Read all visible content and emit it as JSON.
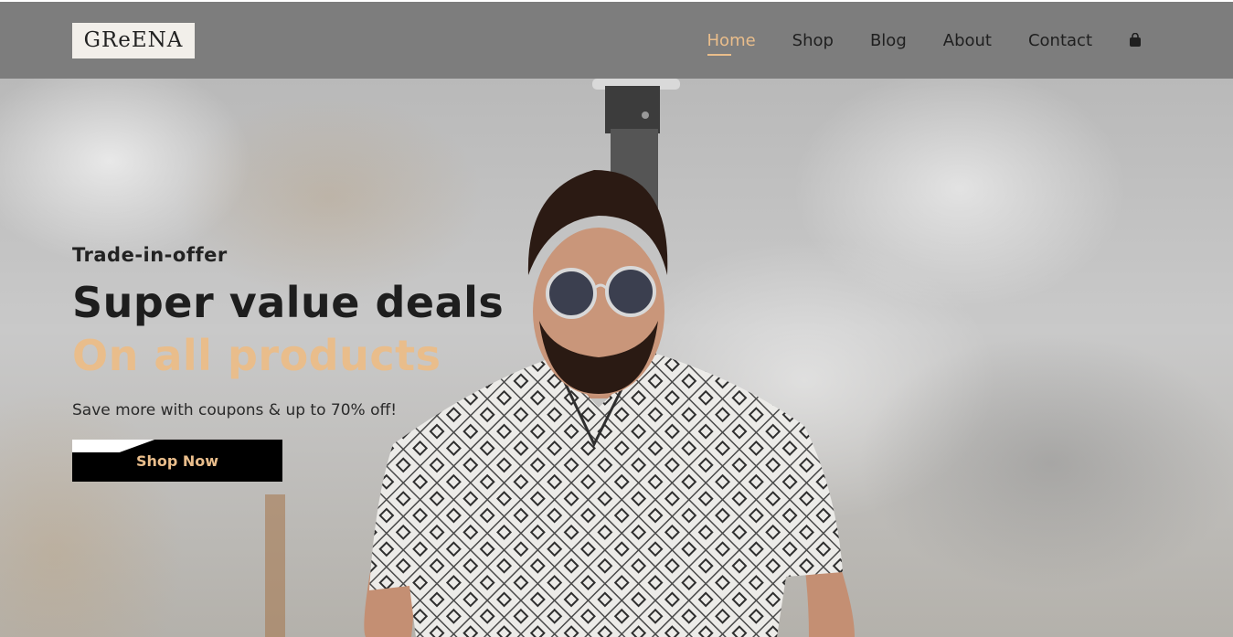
{
  "brand": {
    "logo_text": "GReENA"
  },
  "nav": {
    "items": [
      {
        "label": "Home",
        "active": true
      },
      {
        "label": "Shop",
        "active": false
      },
      {
        "label": "Blog",
        "active": false
      },
      {
        "label": "About",
        "active": false
      },
      {
        "label": "Contact",
        "active": false
      }
    ],
    "cart_icon": "shopping-bag-icon"
  },
  "hero": {
    "eyebrow": "Trade-in-offer",
    "headline": "Super value deals",
    "highlight": "On all products",
    "subtext": "Save more with coupons & up to 70% off!",
    "cta_label": "Shop Now"
  },
  "colors": {
    "accent": "#e9bd8b",
    "header_bg": "#7d7d7d",
    "text_dark": "#1e1e1e",
    "button_bg": "#000000"
  }
}
